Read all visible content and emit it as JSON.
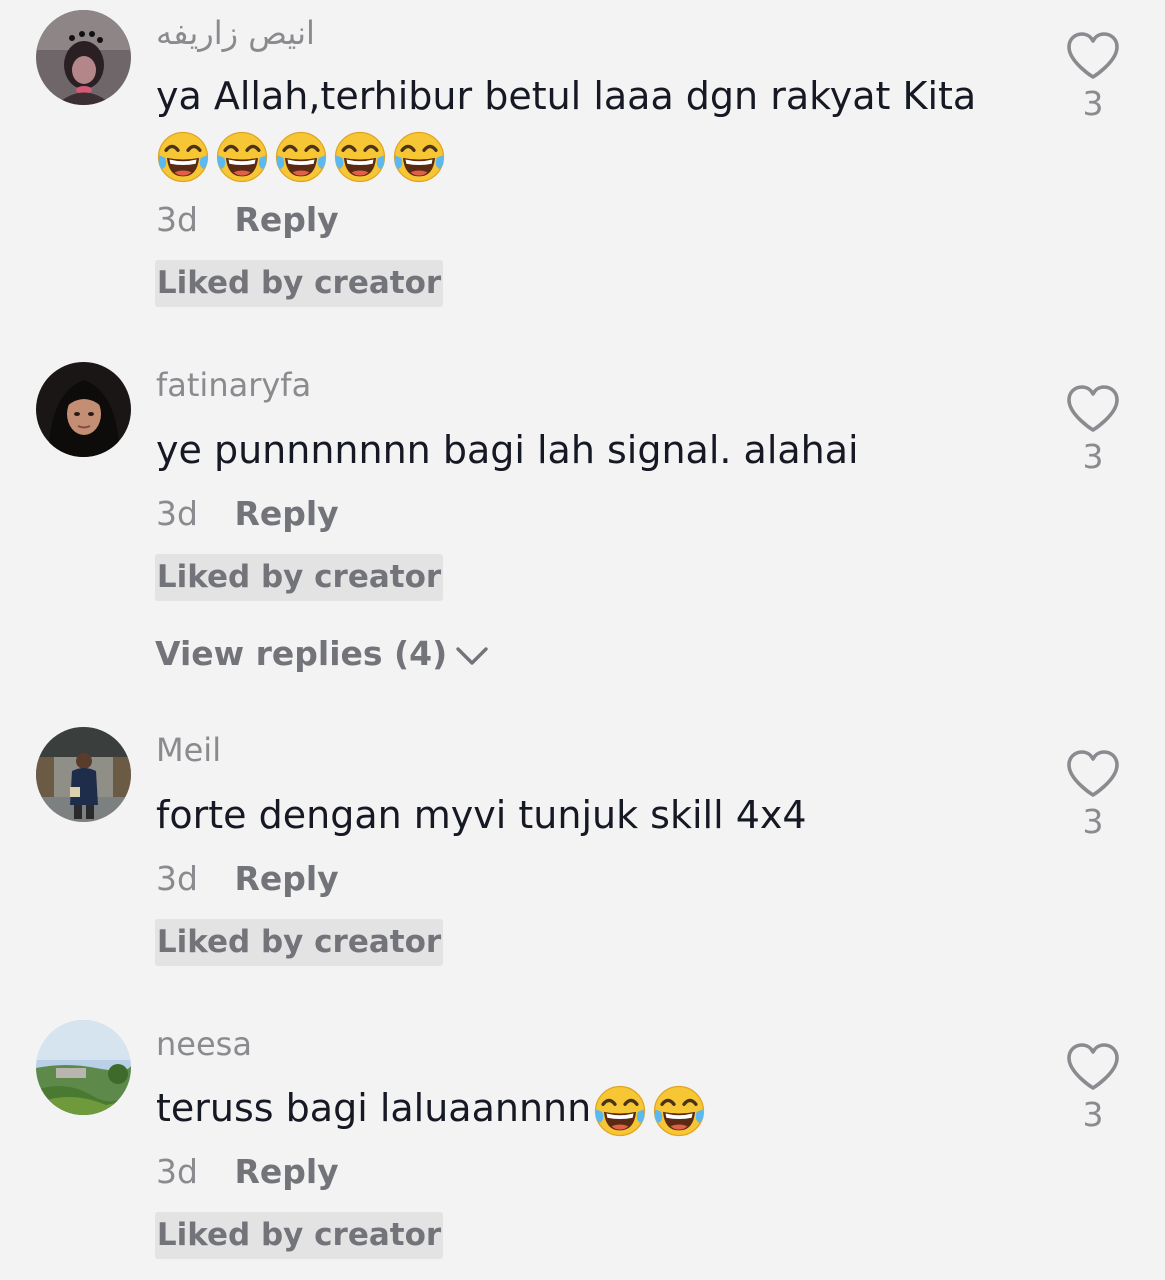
{
  "comments": [
    {
      "username": "انيص زاريفه",
      "text": "ya Allah,terhibur betul laaa dgn rakyat Kita",
      "emoji_count": 5,
      "time": "3d",
      "reply_label": "Reply",
      "badge": "Liked by creator",
      "likes": "3"
    },
    {
      "username": "fatinaryfa",
      "text": "ye punnnnnnn bagi lah signal. alahai",
      "time": "3d",
      "reply_label": "Reply",
      "badge": "Liked by creator",
      "likes": "3",
      "view_replies": "View replies (4)"
    },
    {
      "username": "Meil",
      "text": "forte dengan myvi tunjuk skill 4x4",
      "time": "3d",
      "reply_label": "Reply",
      "badge": "Liked by creator",
      "likes": "3"
    },
    {
      "username": "neesa",
      "text": "teruss bagi laluaannnn",
      "emoji_count": 2,
      "time": "3d",
      "reply_label": "Reply",
      "badge": "Liked by creator",
      "likes": "3"
    }
  ],
  "icons": {
    "like": "heart-outline-icon",
    "expand": "chevron-down-icon",
    "emoji": "face-with-tears-of-joy-emoji"
  },
  "colors": {
    "background": "#f3f3f3",
    "text": "#161823",
    "secondary": "#8a8b8f",
    "badge_bg": "#e3e3e4"
  }
}
